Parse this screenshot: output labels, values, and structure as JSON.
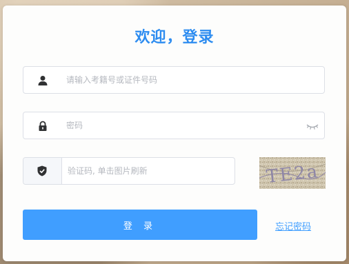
{
  "login": {
    "title": "欢迎，登录",
    "id_placeholder": "请输入考籍号或证件号码",
    "password_placeholder": "密码",
    "captcha_placeholder": "验证码, 单击图片刷新",
    "captcha_text": "TE2a",
    "login_button": "登 录",
    "forgot_link": "忘记密码"
  },
  "colors": {
    "title": "#2d8cf0",
    "button": "#409eff",
    "link": "#409eff"
  },
  "icons": {
    "id_field": "user-icon",
    "password_field": "lock-icon",
    "password_toggle": "eye-closed-icon",
    "captcha_field": "shield-icon"
  }
}
